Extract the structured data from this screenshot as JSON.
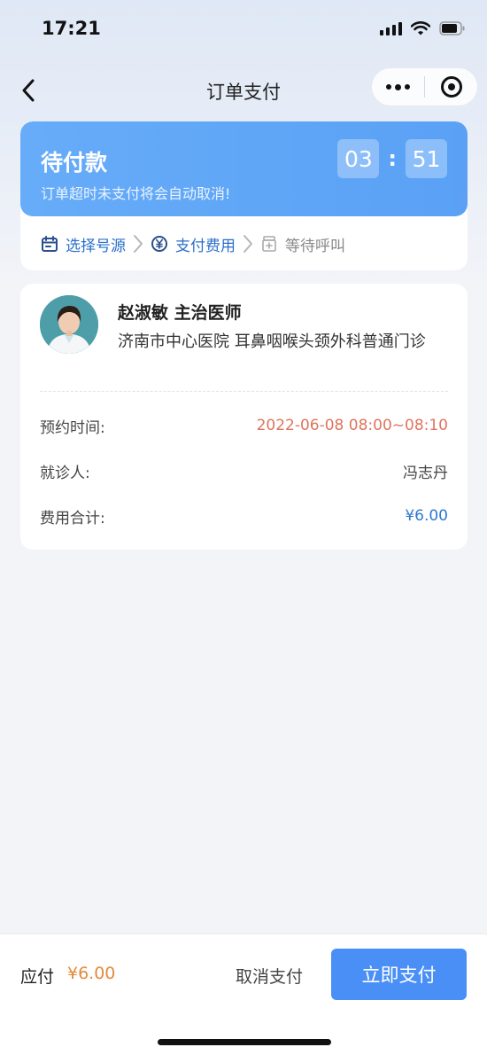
{
  "status_bar": {
    "time": "17:21",
    "signal_icon": "signal-icon",
    "wifi_icon": "wifi-icon",
    "battery_icon": "battery-icon"
  },
  "nav": {
    "title": "订单支付",
    "back_icon": "chevron-left-icon",
    "more_icon": "more-dots-icon",
    "close_icon": "target-close-icon"
  },
  "payment": {
    "status": "待付款",
    "tip": "订单超时未支付将会自动取消!",
    "countdown": {
      "minutes": "03",
      "seconds": "51",
      "separator": ":"
    }
  },
  "steps": [
    {
      "label": "选择号源",
      "icon": "calendar-icon",
      "state": "done"
    },
    {
      "label": "支付费用",
      "icon": "yuan-icon",
      "state": "current"
    },
    {
      "label": "等待呼叫",
      "icon": "medicine-icon",
      "state": "pending"
    }
  ],
  "doctor": {
    "name_title": "赵淑敏 主治医师",
    "hospital_dept": "济南市中心医院 耳鼻咽喉头颈外科普通门诊"
  },
  "details": [
    {
      "label": "预约时间:",
      "value": "2022-06-08 08:00~08:10"
    },
    {
      "label": "就诊人:",
      "value": "冯志丹"
    },
    {
      "label": "费用合计:",
      "value": "¥6.00"
    }
  ],
  "bottom": {
    "due_label": "应付",
    "due_amount": "¥6.00",
    "cancel_label": "取消支付",
    "pay_label": "立即支付"
  },
  "colors": {
    "accent": "#4a8ff6",
    "banner": "#5ea6f7",
    "time_value": "#e0735e",
    "fee_value": "#2f78cf",
    "amount": "#e38a3a"
  }
}
